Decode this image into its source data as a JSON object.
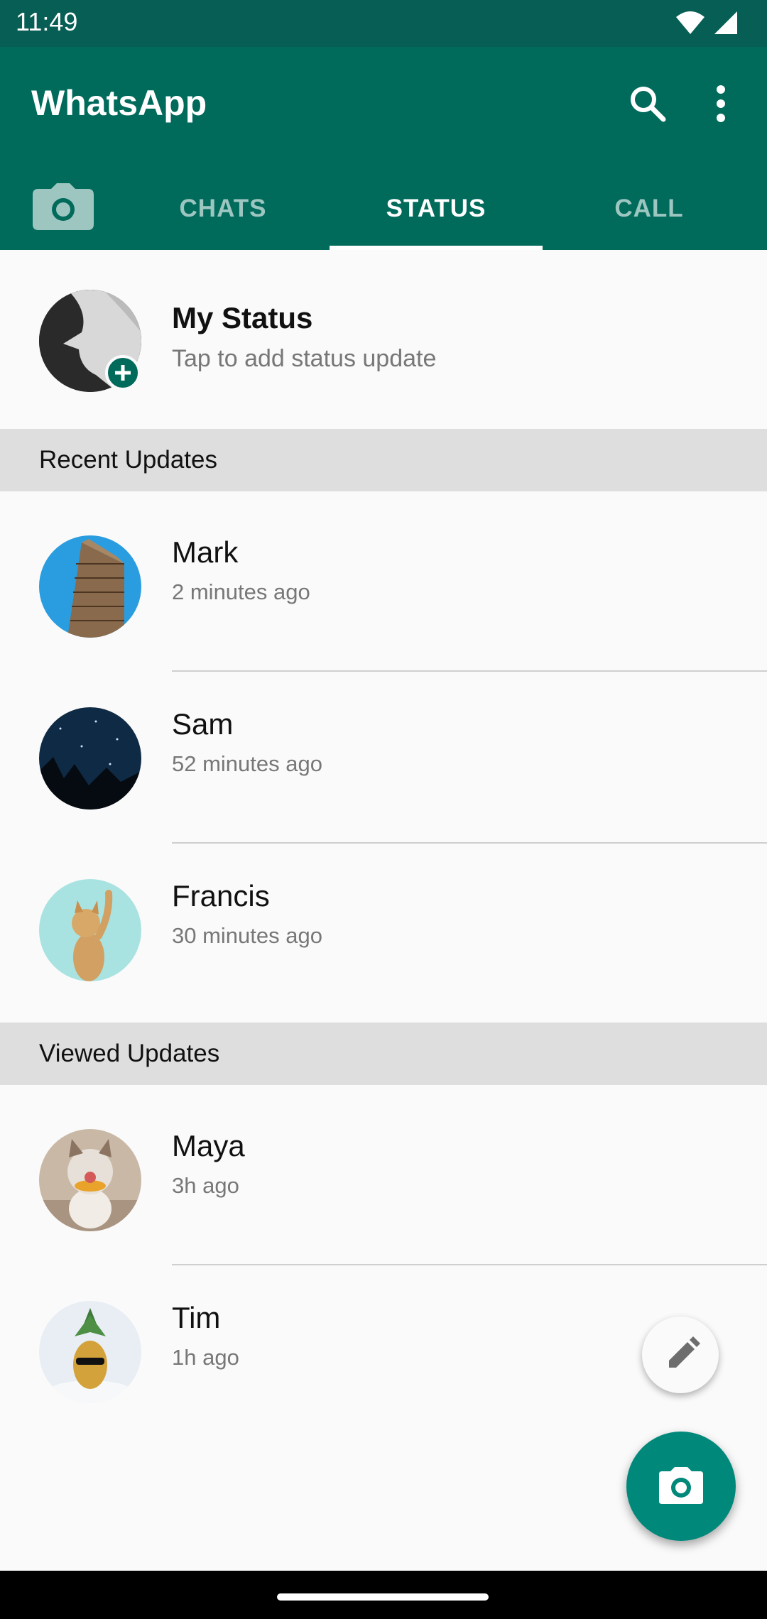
{
  "status_bar": {
    "time": "11:49"
  },
  "app_bar": {
    "title": "WhatsApp"
  },
  "tabs": [
    {
      "label": "CHATS"
    },
    {
      "label": "STATUS",
      "active": true
    },
    {
      "label": "CALL"
    }
  ],
  "my_status": {
    "name": "My Status",
    "subtitle": "Tap to add status update"
  },
  "recent_header": "Recent Updates",
  "recent": [
    {
      "name": "Mark",
      "time": "2 minutes ago"
    },
    {
      "name": "Sam",
      "time": "52 minutes ago"
    },
    {
      "name": "Francis",
      "time": "30 minutes ago"
    }
  ],
  "viewed_header": "Viewed Updates",
  "viewed": [
    {
      "name": "Maya",
      "time": "3h ago"
    },
    {
      "name": "Tim",
      "time": "1h ago"
    }
  ],
  "colors": {
    "primary": "#006a5b",
    "accent": "#00897b",
    "statusbar": "#075e54"
  }
}
